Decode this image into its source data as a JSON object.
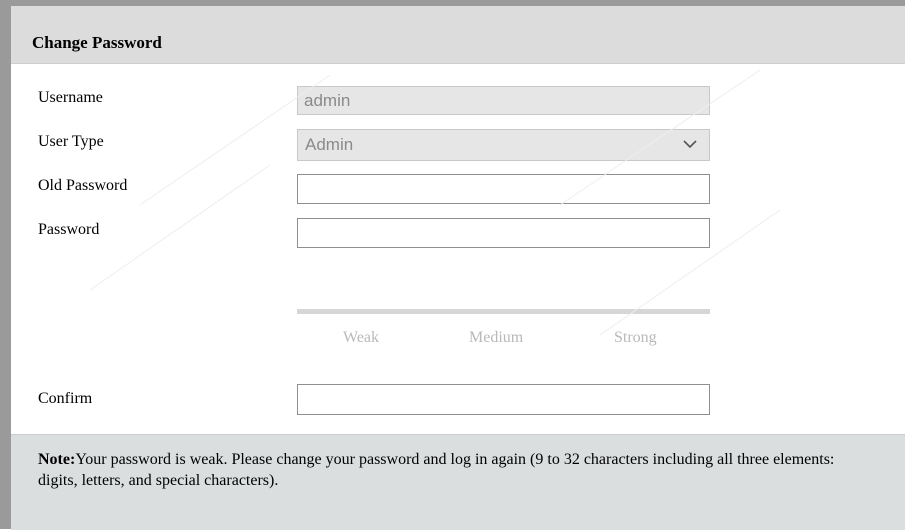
{
  "dialog": {
    "title": "Change Password"
  },
  "form": {
    "username": {
      "label": "Username",
      "value": "admin"
    },
    "user_type": {
      "label": "User Type",
      "selected": "Admin"
    },
    "old_password": {
      "label": "Old Password",
      "value": ""
    },
    "password": {
      "label": "Password",
      "value": ""
    },
    "strength": {
      "weak": "Weak",
      "medium": "Medium",
      "strong": "Strong"
    },
    "confirm": {
      "label": "Confirm",
      "value": ""
    }
  },
  "note": {
    "prefix": "Note:",
    "text": "Your password is weak. Please change your password and log in again (9 to 32 characters including all three elements: digits, letters, and special characters)."
  },
  "colors": {
    "header_bg": "#dcdcdc",
    "note_bg": "#dadedf",
    "disabled_bg": "#e6e6e6",
    "strength_track": "#d6d6d6"
  }
}
